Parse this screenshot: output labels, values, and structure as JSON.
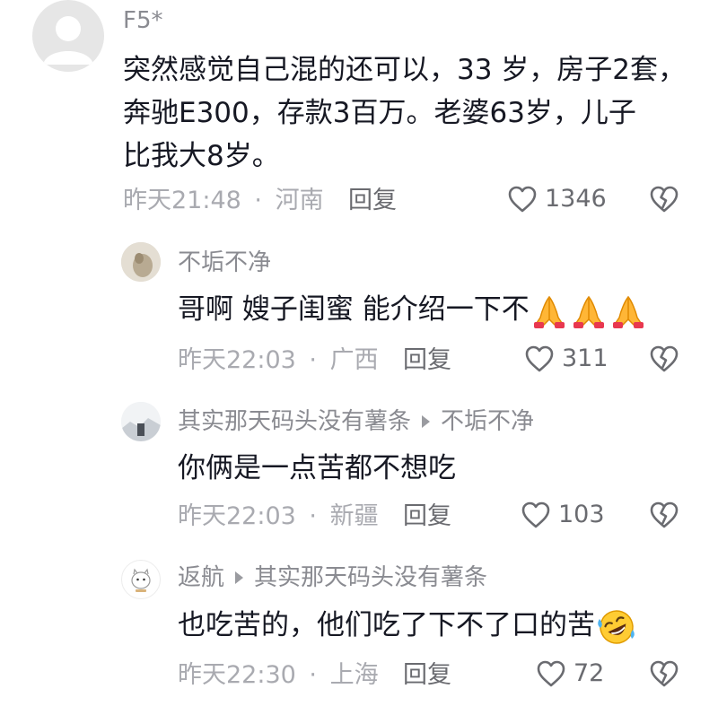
{
  "comments": [
    {
      "user": "F5*",
      "lines": [
        "突然感觉自己混的还可以，33 岁，房子2套，",
        "奔驰E300，存款3百万。老婆63岁，儿子",
        "比我大8岁。"
      ],
      "time": "昨天21:48",
      "location": "河南",
      "reply_label": "回复",
      "likes": "1346"
    },
    {
      "user": "不垢不净",
      "text": "哥啊 嫂子闺蜜 能介绍一下不",
      "emoji": [
        "folded-hands",
        "folded-hands",
        "folded-hands"
      ],
      "time": "昨天22:03",
      "location": "广西",
      "reply_label": "回复",
      "likes": "311"
    },
    {
      "user": "其实那天码头没有薯条",
      "reply_to": "不垢不净",
      "text": "你俩是一点苦都不想吃",
      "time": "昨天22:03",
      "location": "新疆",
      "reply_label": "回复",
      "likes": "103"
    },
    {
      "user": "返航",
      "reply_to": "其实那天码头没有薯条",
      "text": "也吃苦的，他们吃了下不了口的苦",
      "emoji": [
        "rolling-laughing"
      ],
      "time": "昨天22:30",
      "location": "上海",
      "reply_label": "回复",
      "likes": "72"
    }
  ],
  "separator": "·",
  "colors": {
    "text": "#161823",
    "meta": "#a9aab0",
    "username": "#8a8b91",
    "icon": "#6a6b70"
  }
}
